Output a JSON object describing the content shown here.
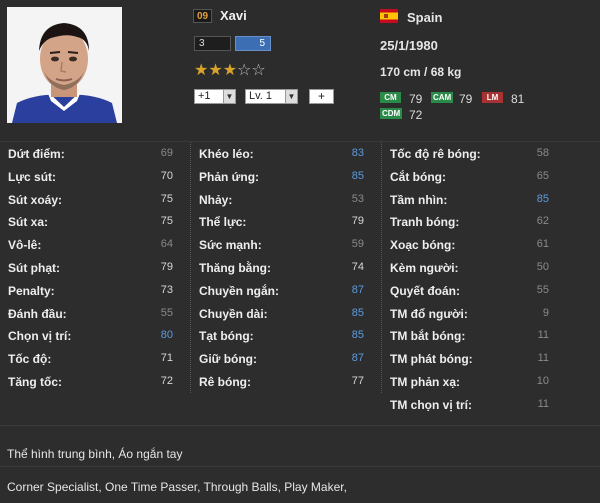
{
  "player": {
    "ovr_badge": "09",
    "name": "Xavi",
    "stat_box_a": "3",
    "stat_box_b": "5",
    "rating_stars": 3,
    "stars_max": 5,
    "upgrade_select": "+1",
    "level_select": "Lv. 1",
    "plus_button": "+",
    "nation": "Spain",
    "dob": "25/1/1980",
    "height_weight": "170 cm / 68 kg",
    "positions": [
      {
        "code": "CM",
        "rating": "79"
      },
      {
        "code": "CAM",
        "rating": "79"
      },
      {
        "code": "LM",
        "rating": "81"
      },
      {
        "code": "CDM",
        "rating": "72"
      }
    ]
  },
  "attributes": {
    "col1": [
      {
        "label": "Dứt điểm:",
        "value": "69",
        "tone": "dim"
      },
      {
        "label": "Lực sút:",
        "value": "70",
        "tone": "norm"
      },
      {
        "label": "Sút xoáy:",
        "value": "75",
        "tone": "norm"
      },
      {
        "label": "Sút xa:",
        "value": "75",
        "tone": "norm"
      },
      {
        "label": "Vô-lê:",
        "value": "64",
        "tone": "dim"
      },
      {
        "label": "Sút phạt:",
        "value": "79",
        "tone": "norm"
      },
      {
        "label": "Penalty:",
        "value": "73",
        "tone": "norm"
      },
      {
        "label": "Đánh đầu:",
        "value": "55",
        "tone": "dim"
      },
      {
        "label": "Chọn vị trí:",
        "value": "80",
        "tone": "blue"
      },
      {
        "label": "Tốc độ:",
        "value": "71",
        "tone": "norm"
      },
      {
        "label": "Tăng tốc:",
        "value": "72",
        "tone": "norm"
      }
    ],
    "col2": [
      {
        "label": "Khéo léo:",
        "value": "83",
        "tone": "blue"
      },
      {
        "label": "Phản ứng:",
        "value": "85",
        "tone": "blue"
      },
      {
        "label": "Nhảy:",
        "value": "53",
        "tone": "dim"
      },
      {
        "label": "Thể lực:",
        "value": "79",
        "tone": "norm"
      },
      {
        "label": "Sức mạnh:",
        "value": "59",
        "tone": "dim"
      },
      {
        "label": "Thăng bằng:",
        "value": "74",
        "tone": "norm"
      },
      {
        "label": "Chuyền ngắn:",
        "value": "87",
        "tone": "blue"
      },
      {
        "label": "Chuyền dài:",
        "value": "85",
        "tone": "blue"
      },
      {
        "label": "Tạt bóng:",
        "value": "85",
        "tone": "blue"
      },
      {
        "label": "Giữ bóng:",
        "value": "87",
        "tone": "blue"
      },
      {
        "label": "Rê bóng:",
        "value": "77",
        "tone": "norm"
      }
    ],
    "col3": [
      {
        "label": "Tốc độ rê bóng:",
        "value": "58",
        "tone": "dim"
      },
      {
        "label": "Cắt bóng:",
        "value": "65",
        "tone": "dim"
      },
      {
        "label": "Tầm nhìn:",
        "value": "85",
        "tone": "blue"
      },
      {
        "label": "Tranh bóng:",
        "value": "62",
        "tone": "dim"
      },
      {
        "label": "Xoạc bóng:",
        "value": "61",
        "tone": "dim"
      },
      {
        "label": "Kèm người:",
        "value": "50",
        "tone": "dim"
      },
      {
        "label": "Quyết đoán:",
        "value": "55",
        "tone": "dim"
      },
      {
        "label": "TM đổ người:",
        "value": "9",
        "tone": "dim"
      },
      {
        "label": "TM bắt bóng:",
        "value": "11",
        "tone": "dim"
      },
      {
        "label": "TM phát bóng:",
        "value": "11",
        "tone": "dim"
      },
      {
        "label": "TM phản xạ:",
        "value": "10",
        "tone": "dim"
      },
      {
        "label": "TM chọn vị trí:",
        "value": "11",
        "tone": "dim"
      }
    ]
  },
  "body_type": "Thể hình trung bình, Áo ngắn tay",
  "traits": "Corner Specialist, One Time Passer, Through Balls, Play Maker,",
  "colors": {
    "accent_blue": "#3c6eb4",
    "value_blue": "#5c9be0",
    "star_gold": "#d8a52a",
    "pos_green": "#2a8a48",
    "pos_red": "#a83232"
  }
}
